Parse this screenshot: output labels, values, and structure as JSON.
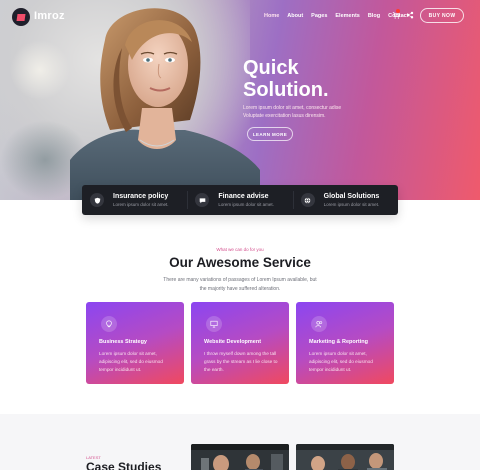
{
  "header": {
    "logo_text": "Imroz",
    "nav": [
      "Home",
      "About",
      "Pages",
      "Elements",
      "Blog",
      "Contact"
    ],
    "buy_button": "BUY NOW"
  },
  "hero": {
    "title_line1": "Quick",
    "title_line2": "Solution.",
    "description": "Lorem ipsum dolor sit amet, consectur adise Voluptate exercitation lasus dirensim.",
    "cta": "LEARN MORE"
  },
  "features": [
    {
      "title": "Insurance policy",
      "subtitle": "Lorem ipsum dolor sit amet.",
      "icon": "shield-icon"
    },
    {
      "title": "Finance advise",
      "subtitle": "Lorem ipsum dolor sit amet.",
      "icon": "chat-icon"
    },
    {
      "title": "Global Solutions",
      "subtitle": "Lorem ipsum dolor sit amet.",
      "icon": "globe-icon"
    }
  ],
  "services": {
    "kicker": "What we can do for you",
    "title": "Our Awesome Service",
    "description": "There are many variations of passages of Lorem Ipsum available, but the majority have suffered alteration.",
    "cards": [
      {
        "title": "Business Strategy",
        "description": "Lorem ipsum dolor sit amet, adipiscing elit, sed do eiusmod tempor incididunt ut.",
        "icon": "lightbulb-icon"
      },
      {
        "title": "Website Development",
        "description": "I throw myself down among the tall grass by the stream as I lie close to the earth.",
        "icon": "monitor-icon"
      },
      {
        "title": "Marketing & Reporting",
        "description": "Lorem ipsum dolor sit amet, adipiscing elit, sed do eiusmod tempor incididunt ut.",
        "icon": "users-icon"
      }
    ]
  },
  "case_studies": {
    "kicker": "LATEST",
    "title": "Case Studies"
  },
  "colors": {
    "accent_pink": "#ef4d6a",
    "accent_purple": "#8b46f1",
    "dark_bar": "#1d1f25"
  }
}
